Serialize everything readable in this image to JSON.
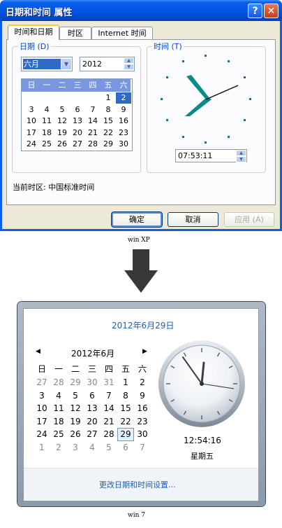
{
  "xp": {
    "title": "日期和时间 属性",
    "help_glyph": "?",
    "close_glyph": "✕",
    "tabs": [
      "时间和日期",
      "时区",
      "Internet 时间"
    ],
    "date_group_label": "日期 (D)",
    "time_group_label": "时间 (T)",
    "month_value": "六月",
    "year_value": "2012",
    "weekday_headers": [
      "日",
      "一",
      "二",
      "三",
      "四",
      "五",
      "六"
    ],
    "calendar_rows": [
      [
        "",
        "",
        "",
        "",
        "",
        "1",
        "2"
      ],
      [
        "3",
        "4",
        "5",
        "6",
        "7",
        "8",
        "9"
      ],
      [
        "10",
        "11",
        "12",
        "13",
        "14",
        "15",
        "16"
      ],
      [
        "17",
        "18",
        "19",
        "20",
        "21",
        "22",
        "23"
      ],
      [
        "24",
        "25",
        "26",
        "27",
        "28",
        "29",
        "30"
      ]
    ],
    "selected_day": "2",
    "time_value": "07:53:11",
    "timezone_text": "当前时区: 中国标准时间",
    "buttons": {
      "ok": "确定",
      "cancel": "取消",
      "apply": "应用 (A)"
    },
    "accent_color": "#0054e3"
  },
  "caption_xp": "win XP",
  "caption_w7": "win 7",
  "win7": {
    "date_link": "2012年6月29日",
    "month_title": "2012年6月",
    "prev_glyph": "◀",
    "next_glyph": "▶",
    "weekday_headers": [
      "日",
      "一",
      "二",
      "三",
      "四",
      "五",
      "六"
    ],
    "calendar_rows": [
      [
        "27",
        "28",
        "29",
        "30",
        "31",
        "1",
        "2"
      ],
      [
        "3",
        "4",
        "5",
        "6",
        "7",
        "8",
        "9"
      ],
      [
        "10",
        "11",
        "12",
        "13",
        "14",
        "15",
        "16"
      ],
      [
        "17",
        "18",
        "19",
        "20",
        "21",
        "22",
        "23"
      ],
      [
        "24",
        "25",
        "26",
        "27",
        "28",
        "29",
        "30"
      ],
      [
        "1",
        "2",
        "3",
        "4",
        "5",
        "6",
        "7"
      ]
    ],
    "time_value": "12:54:16",
    "weekday_value": "星期五",
    "change_link": "更改日期和时间设置...",
    "link_color": "#1d5fb1"
  }
}
